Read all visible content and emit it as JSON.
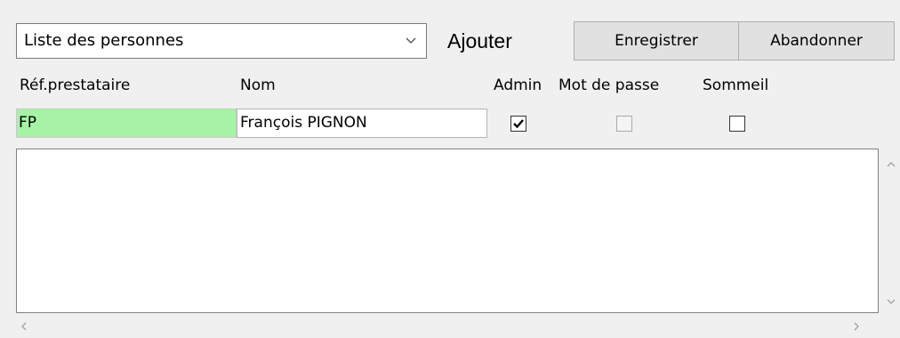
{
  "toolbar": {
    "combo_value": "Liste des personnes",
    "add_label": "Ajouter",
    "save_label": "Enregistrer",
    "cancel_label": "Abandonner"
  },
  "columns": {
    "ref": "Réf.prestataire",
    "nom": "Nom",
    "admin": "Admin",
    "password": "Mot de passe",
    "sleep": "Sommeil"
  },
  "row": {
    "ref": "FP",
    "nom": "François PIGNON",
    "admin": true,
    "password": false,
    "sleep": false
  },
  "colors": {
    "ref_highlight": "#a6f3a6"
  },
  "icons": {
    "combo_arrow": "chevron-down-icon",
    "scroll_up": "chevron-up-icon",
    "scroll_down": "chevron-down-icon",
    "scroll_left": "chevron-left-icon",
    "scroll_right": "chevron-right-icon",
    "check": "check-icon"
  }
}
